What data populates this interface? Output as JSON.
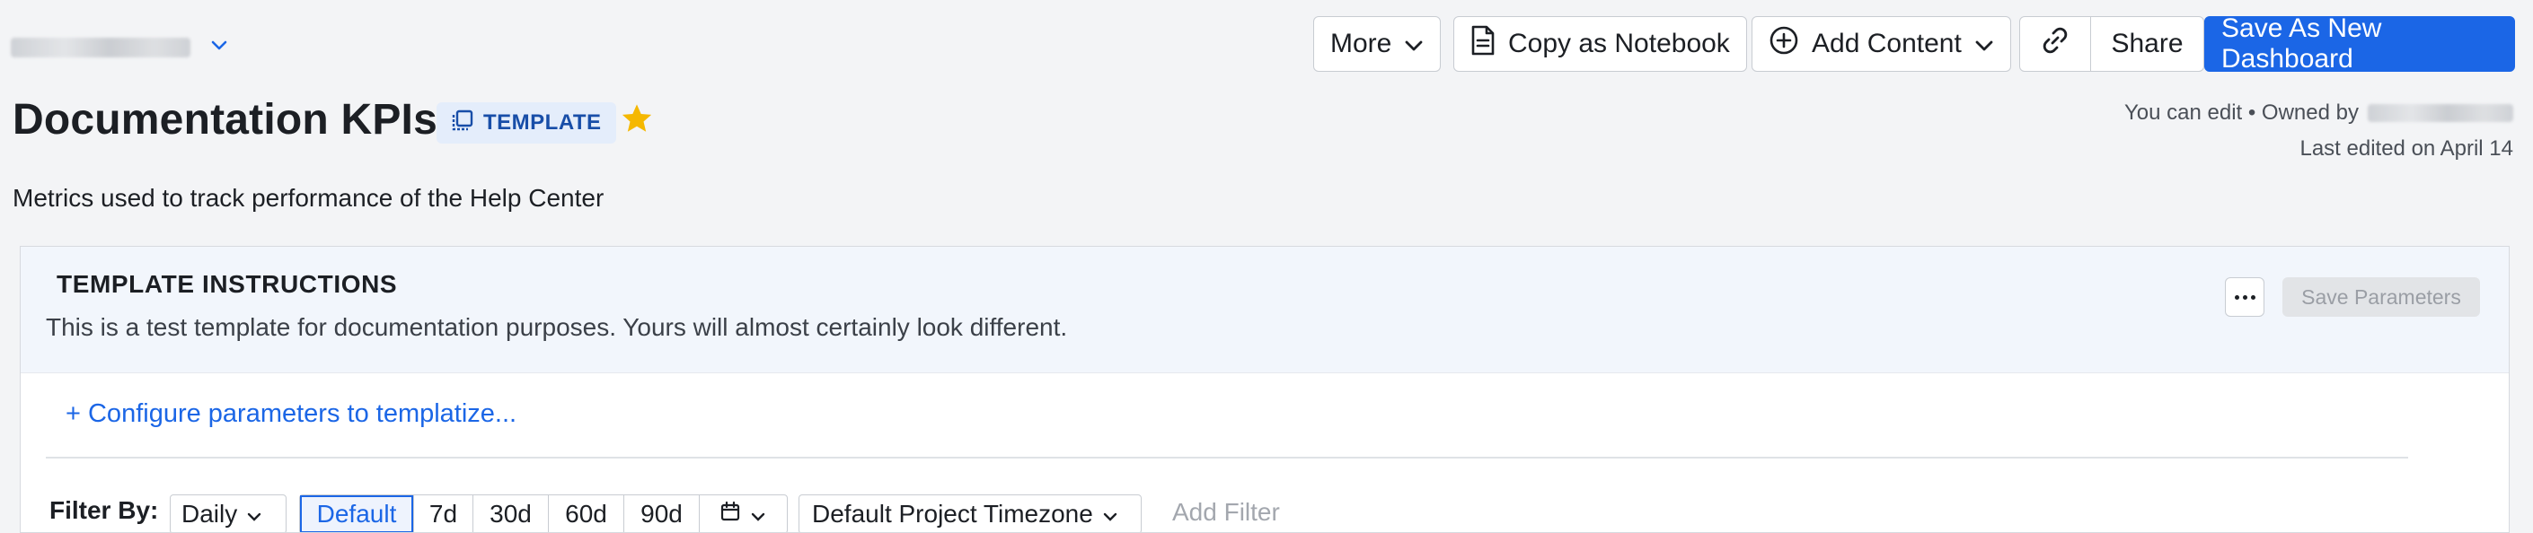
{
  "breadcrumb": {
    "chevron": "chevron-down-icon"
  },
  "toolbar": {
    "more_label": "More",
    "copy_label": "Copy as Notebook",
    "add_content_label": "Add Content",
    "share_label": "Share",
    "save_new_label": "Save As New Dashboard",
    "primary_color": "#1b66e6"
  },
  "dashboard": {
    "title": "Documentation KPIs",
    "badge": "TEMPLATE",
    "description": "Metrics used to track performance of the Help Center",
    "owner_prefix": "You can edit • Owned by",
    "last_edited": "Last edited on April 14",
    "star_color": "#f5b800"
  },
  "template": {
    "heading": "TEMPLATE INSTRUCTIONS",
    "text": "This is a test template for documentation purposes. Yours will almost certainly look different.",
    "save_params": "Save Parameters",
    "configure_link": "+ Configure parameters to templatize..."
  },
  "filters": {
    "label": "Filter By:",
    "interval": "Daily",
    "ranges": [
      "Default",
      "7d",
      "30d",
      "60d",
      "90d"
    ],
    "active_range": "Default",
    "timezone": "Default Project Timezone",
    "add_filter": "Add Filter"
  }
}
